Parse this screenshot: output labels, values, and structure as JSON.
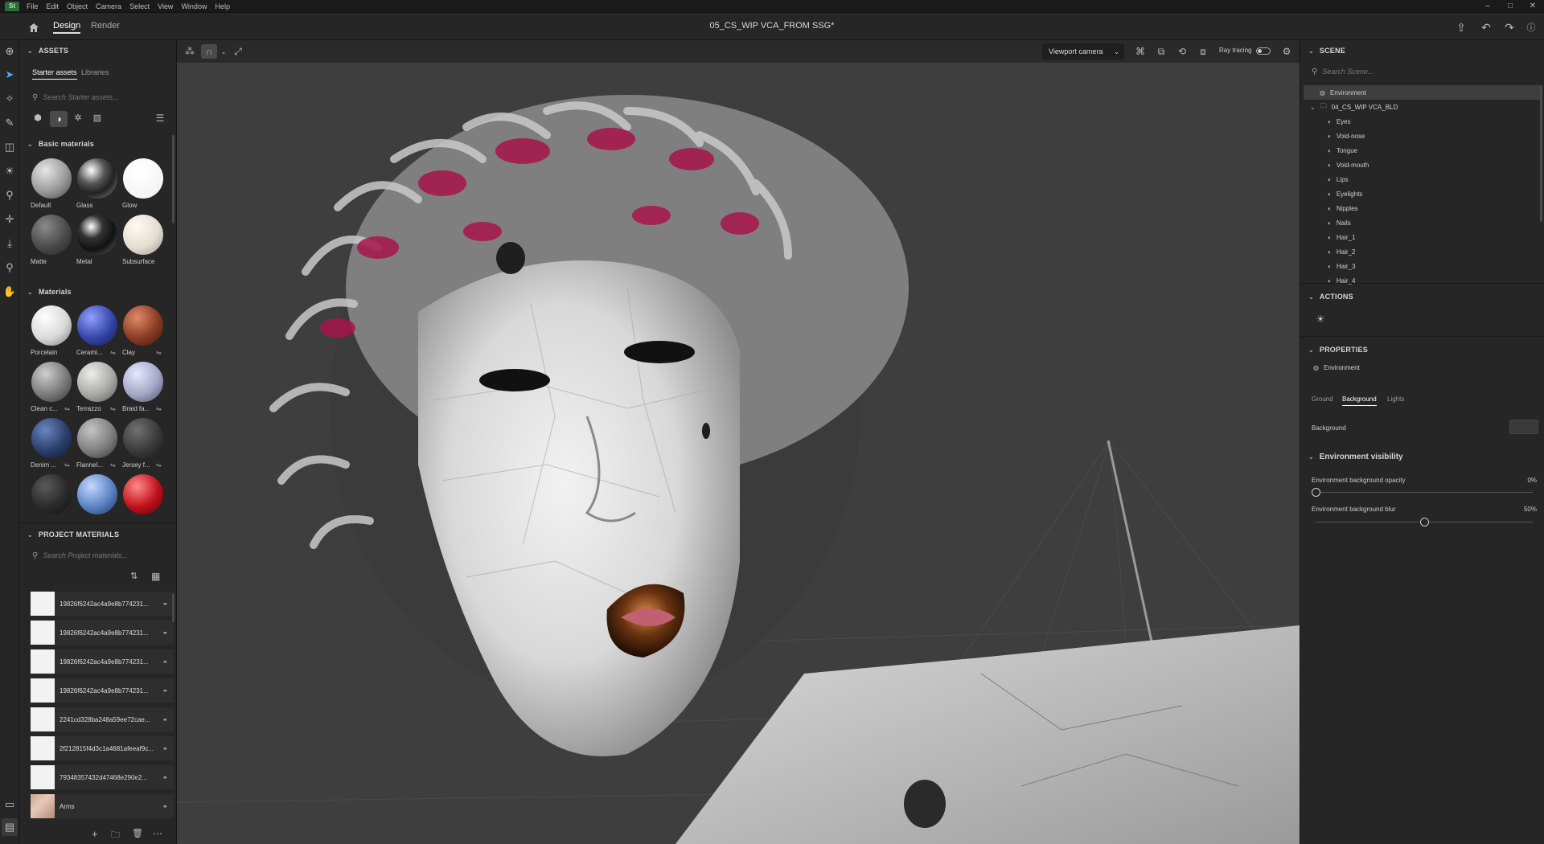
{
  "menubar": {
    "items": [
      "File",
      "Edit",
      "Object",
      "Camera",
      "Select",
      "View",
      "Window",
      "Help"
    ]
  },
  "topbar": {
    "tabs": [
      "Design",
      "Render"
    ],
    "active_tab": "Design",
    "document_title": "05_CS_WIP VCA_FROM SSG*"
  },
  "assets": {
    "header": "ASSETS",
    "tabs": [
      "Starter assets",
      "Libraries"
    ],
    "search_placeholder": "Search Starter assets...",
    "basic_materials": {
      "title": "Basic materials",
      "items": [
        {
          "label": "Default"
        },
        {
          "label": "Glass"
        },
        {
          "label": "Glow"
        },
        {
          "label": "Matte"
        },
        {
          "label": "Metal"
        },
        {
          "label": "Subsurface"
        }
      ]
    },
    "materials": {
      "title": "Materials",
      "items": [
        {
          "label": "Porcelain"
        },
        {
          "label": "Cerami..."
        },
        {
          "label": "Clay"
        },
        {
          "label": "Clean c..."
        },
        {
          "label": "Terrazzo"
        },
        {
          "label": "Braid fa..."
        },
        {
          "label": "Denim ..."
        },
        {
          "label": "Flannel..."
        },
        {
          "label": "Jersey f..."
        },
        {
          "label": ""
        },
        {
          "label": ""
        },
        {
          "label": ""
        }
      ]
    }
  },
  "project_materials": {
    "header": "PROJECT MATERIALS",
    "search_placeholder": "Search Project materials...",
    "items": [
      {
        "name": "19826f6242ac4a9e8b774231..."
      },
      {
        "name": "19826f6242ac4a9e8b774231..."
      },
      {
        "name": "19826f6242ac4a9e8b774231..."
      },
      {
        "name": "19826f6242ac4a9e8b774231..."
      },
      {
        "name": "2241cd328ba248a59ee72cae..."
      },
      {
        "name": "2f212815f4d3c1a4681afeeaf9c..."
      },
      {
        "name": "79348357432d47468e290e2..."
      },
      {
        "name": "Arms"
      }
    ]
  },
  "viewport": {
    "camera": "Viewport camera",
    "ray_tracing_label": "Ray tracing"
  },
  "scene": {
    "header": "SCENE",
    "search_placeholder": "Search Scene...",
    "environment": "Environment",
    "group": "04_CS_WIP VCA_BLD",
    "children": [
      "Eyes",
      "Void-nose",
      "Tongue",
      "Void-mouth",
      "Lips",
      "Eyelights",
      "Nipples",
      "Nails",
      "Hair_1",
      "Hair_2",
      "Hair_3",
      "Hair_4"
    ]
  },
  "actions": {
    "header": "ACTIONS"
  },
  "properties": {
    "header": "PROPERTIES",
    "object": "Environment",
    "tabs": [
      "Ground",
      "Background",
      "Lights"
    ],
    "active_tab": "Background",
    "background_label": "Background",
    "visibility_title": "Environment visibility",
    "opacity_label": "Environment background opacity",
    "opacity_value": "0%",
    "opacity_fraction": 0,
    "blur_label": "Environment background blur",
    "blur_value": "50%",
    "blur_fraction": 0.5
  }
}
